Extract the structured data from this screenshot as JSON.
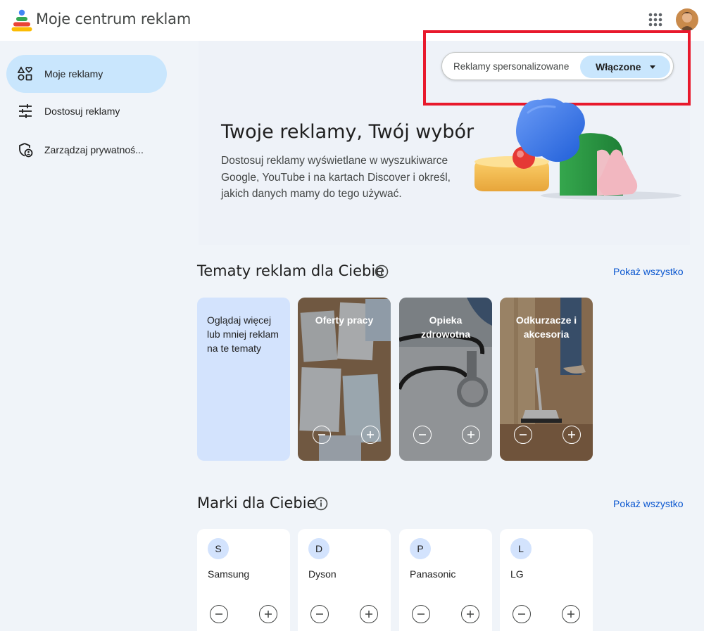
{
  "header": {
    "title": "Moje centrum reklam",
    "logo_icon": "google-ads-center-logo-icon",
    "apps_icon": "apps-grid-icon"
  },
  "sidebar": {
    "items": [
      {
        "label": "Moje reklamy",
        "icon": "ads-shapes-icon",
        "active": true
      },
      {
        "label": "Dostosuj reklamy",
        "icon": "tune-sliders-icon",
        "active": false
      },
      {
        "label": "Zarządzaj prywatnoś...",
        "icon": "privacy-shield-icon",
        "active": false
      }
    ]
  },
  "personalized_ads": {
    "label": "Reklamy spersonalizowane",
    "value": "Włączone"
  },
  "hero": {
    "title": "Twoje reklamy, Twój wybór",
    "description": "Dostosuj reklamy wyświetlane w wyszukiwarce Google, YouTube i na kartach Discover i określ, jakich danych mamy do tego używać."
  },
  "topics": {
    "title": "Tematy reklam dla Ciebie",
    "show_all": "Pokaż wszystko",
    "intro": "Oglądaj więcej lub mniej reklam na te tematy",
    "cards": [
      {
        "title": "Oferty pracy"
      },
      {
        "title": "Opieka zdrowotna"
      },
      {
        "title": "Odkurzacze i akcesoria"
      }
    ]
  },
  "brands": {
    "title": "Marki dla Ciebie",
    "show_all": "Pokaż wszystko",
    "cards": [
      {
        "initial": "S",
        "name": "Samsung"
      },
      {
        "initial": "D",
        "name": "Dyson"
      },
      {
        "initial": "P",
        "name": "Panasonic"
      },
      {
        "initial": "L",
        "name": "LG"
      }
    ]
  },
  "colors": {
    "accent": "#0b57d0",
    "active_nav": "#c9e6fd",
    "background": "#f0f4f9",
    "highlight": "#e8192c"
  }
}
